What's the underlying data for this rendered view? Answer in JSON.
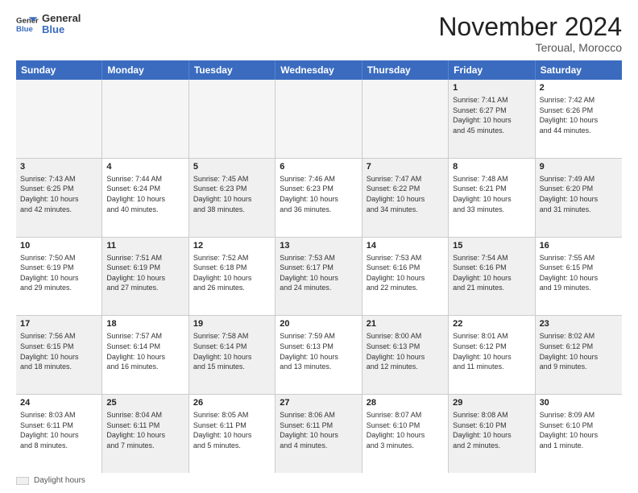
{
  "logo": {
    "line1": "General",
    "line2": "Blue"
  },
  "title": "November 2024",
  "location": "Teroual, Morocco",
  "days": [
    "Sunday",
    "Monday",
    "Tuesday",
    "Wednesday",
    "Thursday",
    "Friday",
    "Saturday"
  ],
  "rows": [
    [
      {
        "day": "",
        "text": "",
        "empty": true
      },
      {
        "day": "",
        "text": "",
        "empty": true
      },
      {
        "day": "",
        "text": "",
        "empty": true
      },
      {
        "day": "",
        "text": "",
        "empty": true
      },
      {
        "day": "",
        "text": "",
        "empty": true
      },
      {
        "day": "1",
        "text": "Sunrise: 7:41 AM\nSunset: 6:27 PM\nDaylight: 10 hours\nand 45 minutes.",
        "shaded": true
      },
      {
        "day": "2",
        "text": "Sunrise: 7:42 AM\nSunset: 6:26 PM\nDaylight: 10 hours\nand 44 minutes.",
        "shaded": false
      }
    ],
    [
      {
        "day": "3",
        "text": "Sunrise: 7:43 AM\nSunset: 6:25 PM\nDaylight: 10 hours\nand 42 minutes.",
        "shaded": true
      },
      {
        "day": "4",
        "text": "Sunrise: 7:44 AM\nSunset: 6:24 PM\nDaylight: 10 hours\nand 40 minutes.",
        "shaded": false
      },
      {
        "day": "5",
        "text": "Sunrise: 7:45 AM\nSunset: 6:23 PM\nDaylight: 10 hours\nand 38 minutes.",
        "shaded": true
      },
      {
        "day": "6",
        "text": "Sunrise: 7:46 AM\nSunset: 6:23 PM\nDaylight: 10 hours\nand 36 minutes.",
        "shaded": false
      },
      {
        "day": "7",
        "text": "Sunrise: 7:47 AM\nSunset: 6:22 PM\nDaylight: 10 hours\nand 34 minutes.",
        "shaded": true
      },
      {
        "day": "8",
        "text": "Sunrise: 7:48 AM\nSunset: 6:21 PM\nDaylight: 10 hours\nand 33 minutes.",
        "shaded": false
      },
      {
        "day": "9",
        "text": "Sunrise: 7:49 AM\nSunset: 6:20 PM\nDaylight: 10 hours\nand 31 minutes.",
        "shaded": true
      }
    ],
    [
      {
        "day": "10",
        "text": "Sunrise: 7:50 AM\nSunset: 6:19 PM\nDaylight: 10 hours\nand 29 minutes.",
        "shaded": false
      },
      {
        "day": "11",
        "text": "Sunrise: 7:51 AM\nSunset: 6:19 PM\nDaylight: 10 hours\nand 27 minutes.",
        "shaded": true
      },
      {
        "day": "12",
        "text": "Sunrise: 7:52 AM\nSunset: 6:18 PM\nDaylight: 10 hours\nand 26 minutes.",
        "shaded": false
      },
      {
        "day": "13",
        "text": "Sunrise: 7:53 AM\nSunset: 6:17 PM\nDaylight: 10 hours\nand 24 minutes.",
        "shaded": true
      },
      {
        "day": "14",
        "text": "Sunrise: 7:53 AM\nSunset: 6:16 PM\nDaylight: 10 hours\nand 22 minutes.",
        "shaded": false
      },
      {
        "day": "15",
        "text": "Sunrise: 7:54 AM\nSunset: 6:16 PM\nDaylight: 10 hours\nand 21 minutes.",
        "shaded": true
      },
      {
        "day": "16",
        "text": "Sunrise: 7:55 AM\nSunset: 6:15 PM\nDaylight: 10 hours\nand 19 minutes.",
        "shaded": false
      }
    ],
    [
      {
        "day": "17",
        "text": "Sunrise: 7:56 AM\nSunset: 6:15 PM\nDaylight: 10 hours\nand 18 minutes.",
        "shaded": true
      },
      {
        "day": "18",
        "text": "Sunrise: 7:57 AM\nSunset: 6:14 PM\nDaylight: 10 hours\nand 16 minutes.",
        "shaded": false
      },
      {
        "day": "19",
        "text": "Sunrise: 7:58 AM\nSunset: 6:14 PM\nDaylight: 10 hours\nand 15 minutes.",
        "shaded": true
      },
      {
        "day": "20",
        "text": "Sunrise: 7:59 AM\nSunset: 6:13 PM\nDaylight: 10 hours\nand 13 minutes.",
        "shaded": false
      },
      {
        "day": "21",
        "text": "Sunrise: 8:00 AM\nSunset: 6:13 PM\nDaylight: 10 hours\nand 12 minutes.",
        "shaded": true
      },
      {
        "day": "22",
        "text": "Sunrise: 8:01 AM\nSunset: 6:12 PM\nDaylight: 10 hours\nand 11 minutes.",
        "shaded": false
      },
      {
        "day": "23",
        "text": "Sunrise: 8:02 AM\nSunset: 6:12 PM\nDaylight: 10 hours\nand 9 minutes.",
        "shaded": true
      }
    ],
    [
      {
        "day": "24",
        "text": "Sunrise: 8:03 AM\nSunset: 6:11 PM\nDaylight: 10 hours\nand 8 minutes.",
        "shaded": false
      },
      {
        "day": "25",
        "text": "Sunrise: 8:04 AM\nSunset: 6:11 PM\nDaylight: 10 hours\nand 7 minutes.",
        "shaded": true
      },
      {
        "day": "26",
        "text": "Sunrise: 8:05 AM\nSunset: 6:11 PM\nDaylight: 10 hours\nand 5 minutes.",
        "shaded": false
      },
      {
        "day": "27",
        "text": "Sunrise: 8:06 AM\nSunset: 6:11 PM\nDaylight: 10 hours\nand 4 minutes.",
        "shaded": true
      },
      {
        "day": "28",
        "text": "Sunrise: 8:07 AM\nSunset: 6:10 PM\nDaylight: 10 hours\nand 3 minutes.",
        "shaded": false
      },
      {
        "day": "29",
        "text": "Sunrise: 8:08 AM\nSunset: 6:10 PM\nDaylight: 10 hours\nand 2 minutes.",
        "shaded": true
      },
      {
        "day": "30",
        "text": "Sunrise: 8:09 AM\nSunset: 6:10 PM\nDaylight: 10 hours\nand 1 minute.",
        "shaded": false
      }
    ]
  ],
  "legend": {
    "daylight_label": "Daylight hours"
  }
}
